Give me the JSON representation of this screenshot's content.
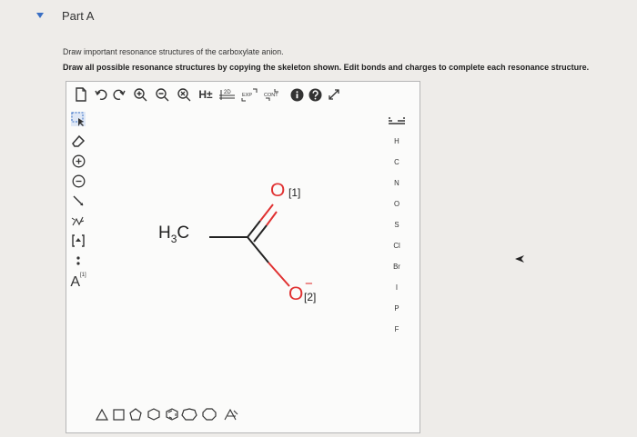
{
  "part": {
    "title": "Part A"
  },
  "instructions": {
    "line1": "Draw important resonance structures of the carboxylate anion.",
    "line2": "Draw all possible resonance structures by copying the skeleton shown. Edit bonds and charges to complete each resonance structure."
  },
  "toolbar": {
    "hydrogen_label": "H±",
    "two_d_label": "2D",
    "exp_label": "EXP",
    "cont_label": "CONT"
  },
  "leftbar": {
    "atom_label": "A",
    "atom_map": "[1]"
  },
  "elements": [
    "H",
    "C",
    "N",
    "O",
    "S",
    "Cl",
    "Br",
    "I",
    "P",
    "F"
  ],
  "molecule": {
    "methyl_h": "H",
    "methyl_sub": "3",
    "methyl_c": "C",
    "oxygen_1": "O",
    "oxygen_1_map": "[1]",
    "oxygen_2": "O",
    "oxygen_2_charge": "−",
    "oxygen_2_map": "[2]"
  },
  "colors": {
    "accent": "#3a6fc4",
    "oxygen": "#e03030",
    "bond": "#222222"
  }
}
